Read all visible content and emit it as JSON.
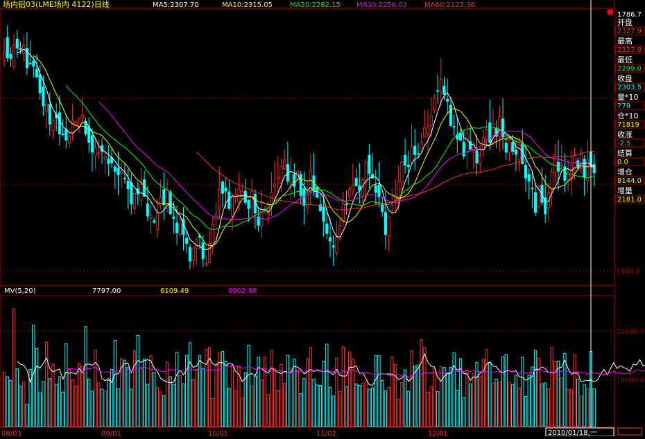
{
  "header": {
    "title": "场内铝03(LME场内 4122)日线",
    "ma_labels": [
      {
        "text": "MA5:2307.70",
        "color": "#ffffff"
      },
      {
        "text": "MA10:2315.05",
        "color": "#ffff00"
      },
      {
        "text": "MA20:2282.15",
        "color": "#00ff00"
      },
      {
        "text": "MA30:2256.03",
        "color": "#ff00ff"
      },
      {
        "text": "MA60:2123.36",
        "color": "#ff3030"
      }
    ]
  },
  "price_axis": {
    "ticks": [
      {
        "label": "1500.0",
        "value": 1500
      }
    ]
  },
  "volume_header": {
    "title": "MV(5,20)",
    "values": [
      {
        "text": "7797.00",
        "color": "#ffffff"
      },
      {
        "text": "6109.49",
        "color": "#ffff00"
      },
      {
        "text": "6902.88",
        "color": "#ff00ff"
      }
    ]
  },
  "volume_axis": {
    "ticks": [
      {
        "label": "20000.0",
        "value": 20000
      },
      {
        "label": "10000.0",
        "value": 10000
      }
    ]
  },
  "date_axis": {
    "labels": [
      "08/03",
      "09/01",
      "10/01",
      "11/02",
      "12/01"
    ],
    "cursor_label": "2010/01/18,一"
  },
  "info_panel": {
    "top_value": "1786.7",
    "items": [
      {
        "label": "开盘",
        "value": "2327.9",
        "value_color": "#ff3030"
      },
      {
        "label": "最高",
        "value": "2327.9",
        "value_color": "#ff3030"
      },
      {
        "label": "最低",
        "value": "2299.0",
        "value_color": "#00ff00"
      },
      {
        "label": "收盘",
        "value": "2303.5",
        "value_color": "#00ffff"
      },
      {
        "label": "量*10",
        "value": "779",
        "value_color": "#00ffff"
      },
      {
        "label": "仓*10",
        "value": "71819",
        "value_color": "#ffff00"
      },
      {
        "label": "收涨",
        "value": "-2.5",
        "value_color": "#00ff00"
      },
      {
        "label": "结算",
        "value": "0.0",
        "value_color": "#ffff00"
      },
      {
        "label": "增仓",
        "value": "8144.0",
        "value_color": "#ffff00"
      },
      {
        "label": "增量",
        "value": "2181.0",
        "value_color": "#ffff00"
      }
    ]
  },
  "colors": {
    "up": "#ff3030",
    "down": "#00ffff",
    "ma5": "#ffffff",
    "ma10": "#ffff00",
    "ma20": "#00ff00",
    "ma30": "#ff00ff",
    "ma60": "#ff3030",
    "grid": "#b00000"
  },
  "chart_data": {
    "type": "candlestick",
    "start_value": 1905,
    "ohlc_changes": [
      [
        6,
        19,
        -9,
        10
      ],
      [
        20,
        16,
        -5,
        -27
      ],
      [
        5,
        9,
        -11,
        -6
      ],
      [
        -10,
        14,
        -4,
        28
      ],
      [
        8,
        12,
        -13,
        -12
      ],
      [
        0,
        9,
        -6,
        -2
      ],
      [
        -5,
        12,
        -11,
        11
      ],
      [
        -4,
        21,
        -9,
        -26
      ],
      [
        6,
        30,
        -1,
        -1
      ],
      [
        4,
        6,
        -15,
        -7
      ],
      [
        -4,
        20,
        -2,
        -10
      ],
      [
        3,
        13,
        -9,
        -24
      ],
      [
        8,
        15,
        -13,
        -25
      ],
      [
        -7,
        8,
        -23,
        9
      ],
      [
        0,
        16,
        -15,
        -26
      ],
      [
        -8,
        3,
        -11,
        13
      ],
      [
        8,
        14,
        -17,
        -5
      ],
      [
        7,
        23,
        -15,
        -28
      ],
      [
        0,
        20,
        -2,
        -1
      ],
      [
        7,
        17,
        -11,
        -14
      ],
      [
        -4,
        5,
        -6,
        9
      ],
      [
        3,
        22,
        -9,
        18
      ],
      [
        -6,
        2,
        -3,
        4
      ],
      [
        -6,
        1,
        -9,
        11
      ],
      [
        0,
        22,
        -6,
        4
      ],
      [
        -8,
        4,
        -3,
        -17
      ],
      [
        10,
        12,
        -14,
        -21
      ],
      [
        9,
        10,
        -25,
        -22
      ],
      [
        -5,
        13,
        -17,
        11
      ],
      [
        -9,
        18,
        -6,
        2
      ],
      [
        10,
        9,
        -16,
        -8
      ],
      [
        -10,
        13,
        -19,
        4
      ],
      [
        -4,
        18,
        -16,
        -6
      ],
      [
        8,
        14,
        -7,
        -7
      ],
      [
        -5,
        3,
        -23,
        -6
      ],
      [
        4,
        22,
        -26,
        -9
      ],
      [
        2,
        11,
        -19,
        3
      ],
      [
        -9,
        20,
        -6,
        -1
      ],
      [
        -3,
        16,
        -26,
        -10
      ],
      [
        8,
        12,
        -14,
        -28
      ],
      [
        -6,
        3,
        -7,
        20
      ],
      [
        6,
        9,
        -14,
        -7
      ],
      [
        -8,
        22,
        -8,
        21
      ],
      [
        6,
        12,
        -1,
        -22
      ],
      [
        -10,
        24,
        -6,
        -16
      ],
      [
        -3,
        17,
        -21,
        4
      ],
      [
        -7,
        4,
        -2,
        -2
      ],
      [
        -10,
        19,
        -11,
        22
      ],
      [
        10,
        23,
        -5,
        11
      ],
      [
        10,
        23,
        -20,
        -20
      ],
      [
        -4,
        14,
        -6,
        24
      ],
      [
        -3,
        3,
        -1,
        -29
      ],
      [
        -4,
        20,
        -20,
        -2
      ],
      [
        -6,
        23,
        -16,
        -13
      ],
      [
        -2,
        11,
        -3,
        13
      ],
      [
        7,
        16,
        -21,
        -20
      ],
      [
        -5,
        10,
        -13,
        -7
      ],
      [
        -5,
        5,
        -11,
        -18
      ],
      [
        1,
        3,
        -10,
        15
      ],
      [
        1,
        3,
        -22,
        11
      ],
      [
        5,
        4,
        -16,
        -2
      ],
      [
        -7,
        10,
        -11,
        -21
      ],
      [
        -8,
        10,
        -3,
        2
      ],
      [
        1,
        18,
        -2,
        25
      ],
      [
        -4,
        10,
        -10,
        29
      ],
      [
        6,
        16,
        -7,
        7
      ],
      [
        7,
        30,
        -13,
        26
      ],
      [
        10,
        3,
        -18,
        -15
      ],
      [
        7,
        14,
        -23,
        -4
      ],
      [
        -1,
        15,
        -3,
        -22
      ],
      [
        -10,
        4,
        -19,
        26
      ],
      [
        -1,
        8,
        -9,
        4
      ],
      [
        -10,
        23,
        -12,
        16
      ],
      [
        -9,
        11,
        -1,
        7
      ],
      [
        0,
        16,
        -3,
        -15
      ],
      [
        3,
        1,
        -17,
        -11
      ],
      [
        1,
        17,
        -11,
        21
      ],
      [
        -3,
        6,
        -21,
        -25
      ],
      [
        -5,
        13,
        -8,
        -11
      ],
      [
        -1,
        25,
        -15,
        22
      ],
      [
        -1,
        4,
        -5,
        2
      ],
      [
        -8,
        4,
        -12,
        13
      ],
      [
        -1,
        27,
        -14,
        17
      ],
      [
        8,
        30,
        -23,
        4
      ],
      [
        6,
        28,
        -21,
        2
      ],
      [
        -8,
        12,
        -11,
        22
      ],
      [
        -3,
        14,
        -2,
        12
      ],
      [
        -6,
        30,
        -5,
        -22
      ],
      [
        -2,
        19,
        -22,
        15
      ],
      [
        -4,
        15,
        -14,
        -16
      ],
      [
        10,
        1,
        -3,
        10
      ],
      [
        -4,
        5,
        -12,
        -28
      ],
      [
        9,
        23,
        -25,
        -22
      ],
      [
        -3,
        19,
        -9,
        17
      ],
      [
        4,
        21,
        -18,
        29
      ],
      [
        -8,
        30,
        -7,
        -20
      ],
      [
        5,
        1,
        -2,
        -13
      ],
      [
        -10,
        16,
        -1,
        -8
      ],
      [
        5,
        19,
        -20,
        -19
      ],
      [
        -3,
        20,
        -7,
        -13
      ],
      [
        -5,
        26,
        -21,
        -5
      ],
      [
        -6,
        14,
        -24,
        -2
      ],
      [
        -7,
        23,
        -5,
        19
      ],
      [
        -1,
        9,
        -2,
        18
      ],
      [
        6,
        16,
        -8,
        22
      ],
      [
        0,
        18,
        -13,
        -1
      ],
      [
        10,
        4,
        -3,
        11
      ],
      [
        -1,
        29,
        -8,
        5
      ],
      [
        10,
        12,
        -1,
        -10
      ],
      [
        0,
        30,
        -18,
        -6
      ],
      [
        -8,
        3,
        -10,
        22
      ],
      [
        -4,
        4,
        -25,
        27
      ],
      [
        9,
        15,
        -20,
        -24
      ],
      [
        -1,
        28,
        -1,
        -5
      ],
      [
        -10,
        21,
        -16,
        -9
      ],
      [
        10,
        30,
        -13,
        -16
      ],
      [
        -10,
        11,
        -7,
        -9
      ],
      [
        -1,
        27,
        -20,
        -29
      ],
      [
        -2,
        1,
        -20,
        26
      ],
      [
        8,
        23,
        -5,
        6
      ],
      [
        9,
        21,
        -16,
        5
      ],
      [
        -3,
        21,
        -17,
        21
      ],
      [
        -1,
        9,
        -11,
        26
      ],
      [
        9,
        22,
        -11,
        -13
      ],
      [
        0,
        19,
        -24,
        -2
      ],
      [
        5,
        29,
        -2,
        22
      ],
      [
        0,
        23,
        -21,
        -11
      ],
      [
        1,
        14,
        -3,
        -1
      ],
      [
        4,
        13,
        -1,
        12
      ],
      [
        7,
        24,
        -1,
        12
      ],
      [
        -7,
        22,
        -23,
        9
      ],
      [
        1,
        24,
        -15,
        13
      ],
      [
        8,
        4,
        -5,
        16
      ],
      [
        9,
        21,
        -16,
        -1
      ],
      [
        0,
        28,
        -20,
        16
      ],
      [
        -9,
        12,
        -7,
        -11
      ],
      [
        -6,
        27,
        -17,
        -3
      ],
      [
        -5,
        11,
        -1,
        -27
      ],
      [
        -1,
        15,
        -11,
        -1
      ],
      [
        -10,
        23,
        -18,
        -6
      ],
      [
        8,
        6,
        -2,
        -9
      ],
      [
        -3,
        16,
        -4,
        -18
      ],
      [
        6,
        12,
        -23,
        23
      ],
      [
        -10,
        20,
        -2,
        -10
      ],
      [
        -2,
        3,
        -24,
        9
      ],
      [
        -9,
        21,
        -16,
        -16
      ],
      [
        -1,
        11,
        -13,
        11
      ],
      [
        7,
        11,
        -10,
        16
      ],
      [
        -3,
        13,
        -7,
        14
      ],
      [
        9,
        30,
        -10,
        -26
      ],
      [
        -1,
        20,
        -4,
        25
      ],
      [
        -5,
        10,
        -16,
        -11
      ],
      [
        0,
        14,
        -20,
        26
      ],
      [
        -3,
        27,
        -17,
        -24
      ],
      [
        -8,
        11,
        -10,
        -12
      ],
      [
        -1,
        6,
        -11,
        18
      ],
      [
        -4,
        10,
        -5,
        -12
      ],
      [
        2,
        15,
        -22,
        -6
      ],
      [
        -7,
        10,
        -15,
        20
      ],
      [
        1,
        19,
        -1,
        -26
      ],
      [
        -2,
        26,
        -18,
        -17
      ],
      [
        5,
        8,
        -24,
        -9
      ],
      [
        -9,
        23,
        -25,
        -1
      ],
      [
        -5,
        13,
        -5,
        -26
      ],
      [
        8,
        2,
        -3,
        26
      ],
      [
        2,
        23,
        -4,
        -23
      ],
      [
        6,
        30,
        -12,
        -21
      ],
      [
        8,
        13,
        -18,
        20
      ],
      [
        3,
        6,
        -21,
        24
      ],
      [
        0,
        14,
        -14,
        23
      ],
      [
        -10,
        29,
        -25,
        -12
      ],
      [
        7,
        26,
        -4,
        1
      ],
      [
        -2,
        18,
        -15,
        -18
      ],
      [
        1,
        18,
        -15,
        9
      ],
      [
        -8,
        19,
        -22,
        18
      ],
      [
        -9,
        10,
        -10,
        22
      ],
      [
        -7,
        4,
        -5,
        -8
      ],
      [
        -2,
        9,
        -7,
        18
      ],
      [
        -6,
        5,
        -24,
        -24
      ],
      [
        -4,
        25,
        -16,
        27
      ],
      [
        10,
        11,
        -3,
        -19
      ],
      [
        3,
        14,
        -17,
        -11
      ]
    ],
    "volume": [
      11200,
      10300,
      9500,
      24300,
      11900,
      8300,
      9200,
      4600,
      11800,
      20900,
      16100,
      7000,
      9300,
      17400,
      9900,
      12900,
      8700,
      10300,
      7100,
      17100,
      11700,
      9600,
      8400,
      13100,
      12400,
      20600,
      9800,
      7300,
      15800,
      9000,
      7700,
      7400,
      9500,
      11800,
      17800,
      7800,
      14000,
      13700,
      12200,
      7700,
      15600,
      18800,
      11900,
      13900,
      8700,
      14600,
      11200,
      8100,
      7100,
      6400,
      13300,
      10300,
      8700,
      15300,
      10500,
      8800,
      14700,
      17300,
      9800,
      11700,
      14700,
      12000,
      15900,
      16300,
      5800,
      13000,
      15200,
      15500,
      13500,
      7900,
      12700,
      7400,
      12500,
      5900,
      11100,
      16800,
      8400,
      10400,
      14300,
      9600,
      14300,
      6600,
      15700,
      12000,
      7500,
      12800,
      8900,
      14700,
      12000,
      13900,
      11700,
      6800,
      9900,
      14000,
      16300,
      9800,
      8600,
      8500,
      13500,
      17000,
      8100,
      6300,
      14100,
      7200,
      16400,
      8200,
      15400,
      13900,
      8800,
      8500,
      8900,
      9300,
      7700,
      8000,
      14700,
      14600,
      9500,
      7400,
      8100,
      14400,
      12800,
      5700,
      9100,
      11700,
      7300,
      15600,
      12500,
      12700,
      17900,
      16300,
      7100,
      8200,
      11900,
      7200,
      12300,
      12200,
      11000,
      12200,
      15200,
      7500,
      14000,
      5900,
      11600,
      8800,
      11000,
      13200,
      10400,
      13900,
      15900,
      13200,
      9000,
      9800,
      9200,
      14400,
      14900,
      9200,
      8700,
      10600,
      8000,
      14300,
      6200,
      10600,
      12300,
      15700,
      14100,
      8800,
      9000,
      7900,
      16300,
      13500,
      13500,
      10100,
      15100,
      7700,
      7600,
      14800,
      9800,
      6300,
      8700,
      7800,
      15500,
      7800,
      8100,
      14800,
      12600,
      10100,
      14100,
      14400,
      8700,
      15400,
      8300,
      12700,
      11900,
      16000,
      14600,
      13700,
      6300,
      13300
    ]
  }
}
